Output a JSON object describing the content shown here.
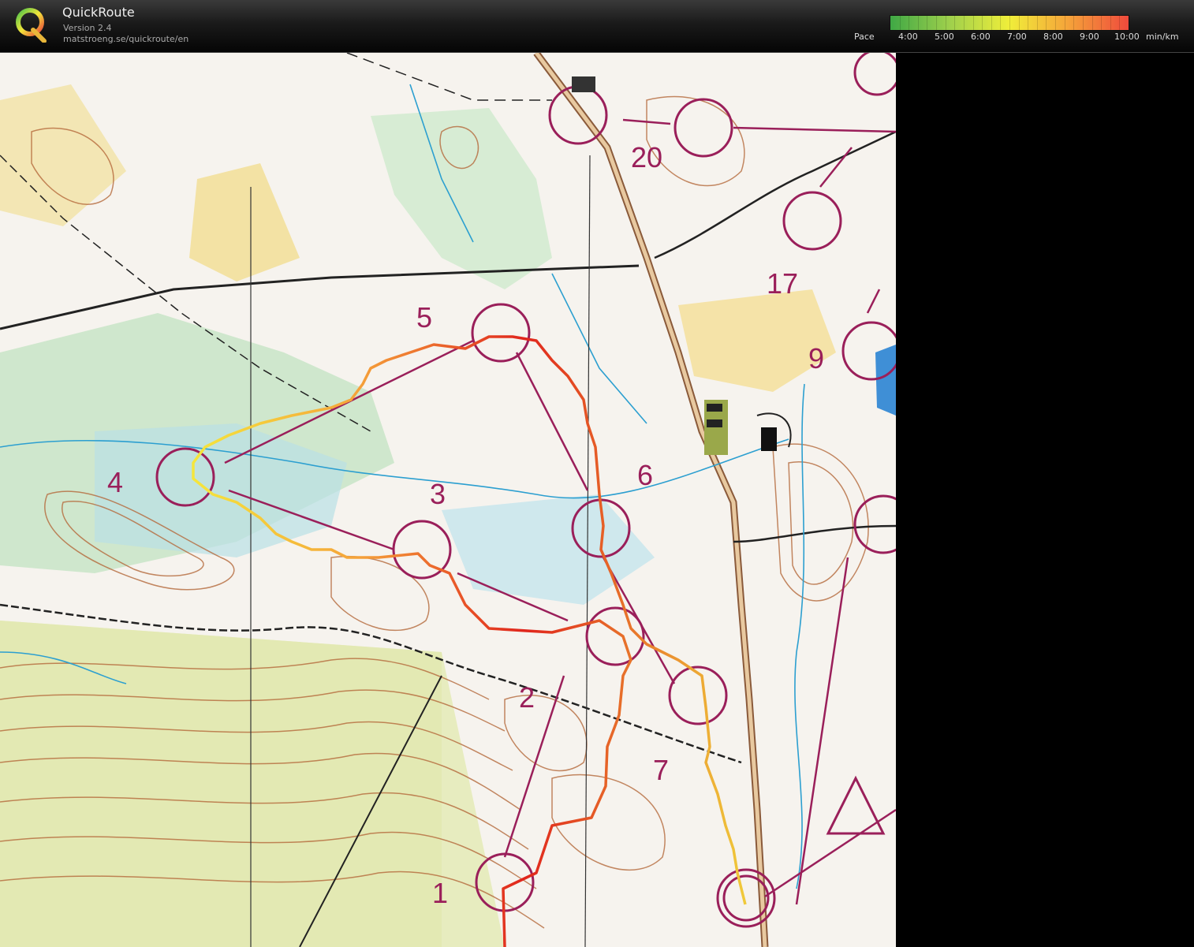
{
  "app": {
    "title": "QuickRoute",
    "version": "Version 2.4",
    "url": "matstroeng.se/quickroute/en"
  },
  "pace_legend": {
    "label": "Pace",
    "ticks": [
      "4:00",
      "5:00",
      "6:00",
      "7:00",
      "8:00",
      "9:00",
      "10:00"
    ],
    "unit": "min/km",
    "gradient_colors": [
      "#3fa845",
      "#9fd04c",
      "#f0ee3a",
      "#f5a23a",
      "#ef4a3c"
    ]
  },
  "map": {
    "control_numbers": [
      "20",
      "17",
      "5",
      "9",
      "4",
      "3",
      "6",
      "2",
      "7",
      "1"
    ],
    "route_color_fast": "#f5e63c",
    "route_color_slow": "#e0251c",
    "course_color": "#9a1f5a"
  }
}
